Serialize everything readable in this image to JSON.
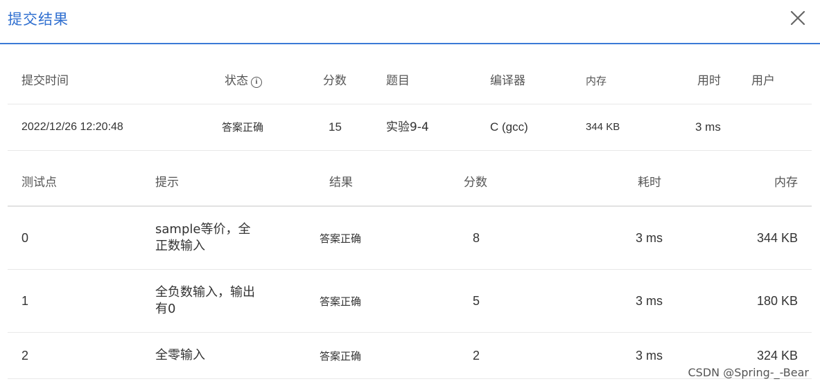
{
  "dialog": {
    "title": "提交结果",
    "close_icon": "close-icon"
  },
  "summary": {
    "headers": {
      "submit_time": "提交时间",
      "status": "状态",
      "score": "分数",
      "problem": "题目",
      "compiler": "编译器",
      "memory": "内存",
      "time": "用时",
      "user": "用户"
    },
    "row": {
      "submit_time": "2022/12/26 12:20:48",
      "status": "答案正确",
      "score": "15",
      "problem": "实验9-4",
      "compiler": "C (gcc)",
      "memory": "344 KB",
      "time": "3 ms",
      "user": ""
    }
  },
  "tests": {
    "headers": {
      "point": "测试点",
      "hint": "提示",
      "result": "结果",
      "score": "分数",
      "time": "耗时",
      "memory": "内存"
    },
    "rows": [
      {
        "point": "0",
        "hint": "sample等价，全正数输入",
        "result": "答案正确",
        "score": "8",
        "time": "3 ms",
        "memory": "344 KB"
      },
      {
        "point": "1",
        "hint": "全负数输入，输出有0",
        "result": "答案正确",
        "score": "5",
        "time": "3 ms",
        "memory": "180 KB"
      },
      {
        "point": "2",
        "hint": "全零输入",
        "result": "答案正确",
        "score": "2",
        "time": "3 ms",
        "memory": "324 KB"
      }
    ]
  },
  "colors": {
    "accent": "#2f6fd0",
    "success_text": "#e8403a"
  },
  "watermark": "CSDN @Spring-_-Bear"
}
